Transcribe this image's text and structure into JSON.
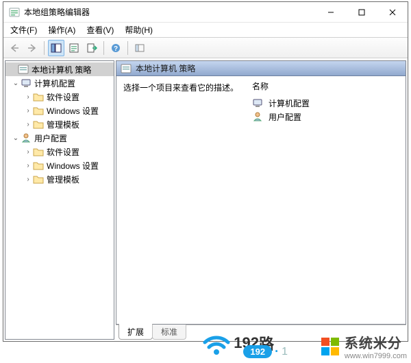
{
  "window": {
    "title": "本地组策略编辑器"
  },
  "menu": {
    "file": "文件(F)",
    "action": "操作(A)",
    "view": "查看(V)",
    "help": "帮助(H)"
  },
  "tree": {
    "root": "本地计算机 策略",
    "computer": "计算机配置",
    "user": "用户配置",
    "software": "软件设置",
    "windows": "Windows 设置",
    "templates": "管理模板"
  },
  "right": {
    "header": "本地计算机 策略",
    "description": "选择一个项目来查看它的描述。",
    "name_col": "名称",
    "items": {
      "computer": "计算机配置",
      "user": "用户配置"
    }
  },
  "tabs": {
    "extended": "扩展",
    "standard": "标准"
  },
  "branding": {
    "wifi_prefix": "192",
    "wifi_suffix": "路",
    "logo_main": "系统米分",
    "logo_sub": "www.win7999.com",
    "pill_text": "192",
    "pill_suffix": "1"
  }
}
